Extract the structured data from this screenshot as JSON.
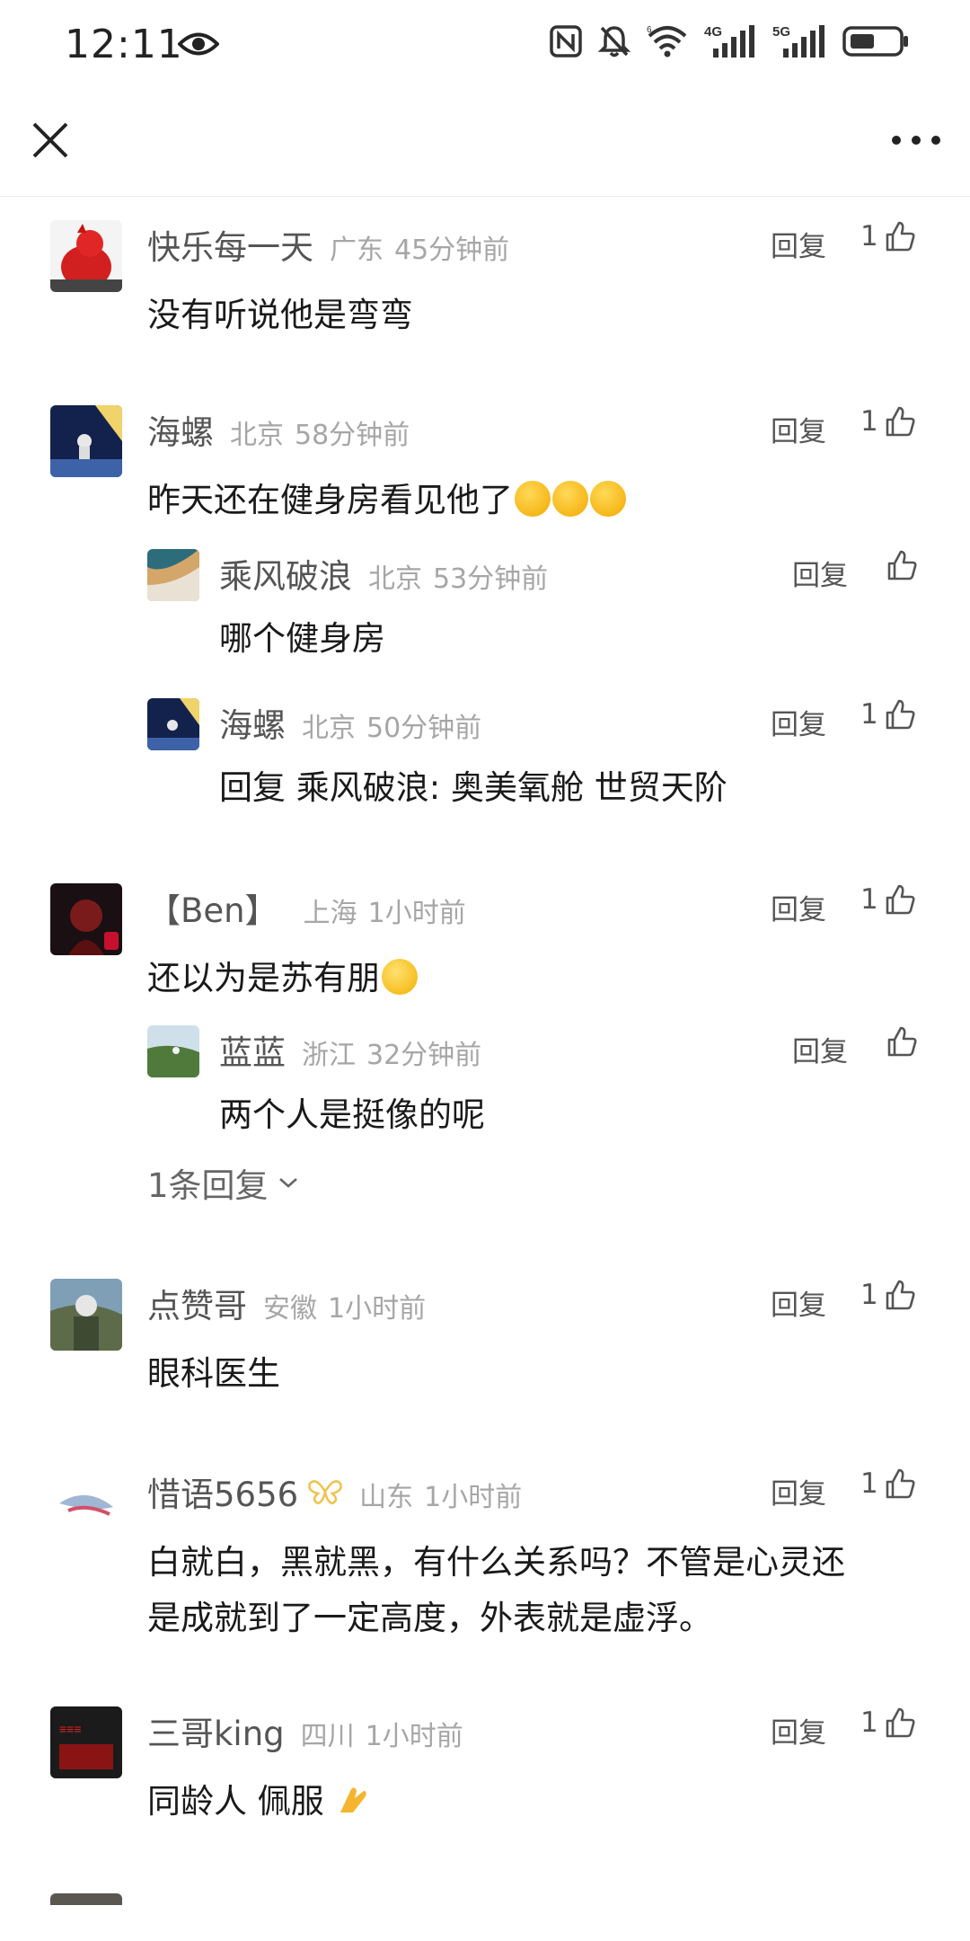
{
  "status": {
    "time": "12:11",
    "net1": "4G",
    "net2": "5G"
  },
  "nav": {
    "close_icon": "close-icon",
    "more_icon": "more-icon"
  },
  "reply_label": "回复",
  "comments": [
    {
      "name": "快乐每一天",
      "location": "广东",
      "time": "45分钟前",
      "likes": "1",
      "text": "没有听说他是弯弯"
    },
    {
      "name": "海螺",
      "location": "北京",
      "time": "58分钟前",
      "likes": "1",
      "text": "昨天还在健身房看见他了"
    },
    {
      "name": "乘风破浪",
      "location": "北京",
      "time": "53分钟前",
      "likes": "",
      "text": "哪个健身房"
    },
    {
      "name": "海螺",
      "location": "北京",
      "time": "50分钟前",
      "likes": "1",
      "text": "回复 乘风破浪: 奥美氧舱 世贸天阶"
    },
    {
      "name": "【Ben】",
      "location": "上海",
      "time": "1小时前",
      "likes": "1",
      "text": "还以为是苏有朋"
    },
    {
      "name": "蓝蓝",
      "location": "浙江",
      "time": "32分钟前",
      "likes": "",
      "text": "两个人是挺像的呢"
    },
    {
      "name": "点赞哥",
      "location": "安徽",
      "time": "1小时前",
      "likes": "1",
      "text": "眼科医生"
    },
    {
      "name": "惜语5656",
      "location": "山东",
      "time": "1小时前",
      "likes": "1",
      "text_line1": "白就白，黑就黑，有什么关系吗？不管是心灵还",
      "text_line2": "是成就到了一定高度，外表就是虚浮。"
    },
    {
      "name": "三哥king",
      "location": "四川",
      "time": "1小时前",
      "likes": "1",
      "text": "同龄人 佩服"
    }
  ],
  "expand_replies": "1条回复",
  "colors": {
    "meta_gray": "#a6a6a6",
    "name_gray": "#555555",
    "text": "#1a1a1a",
    "divider": "#ececec"
  }
}
